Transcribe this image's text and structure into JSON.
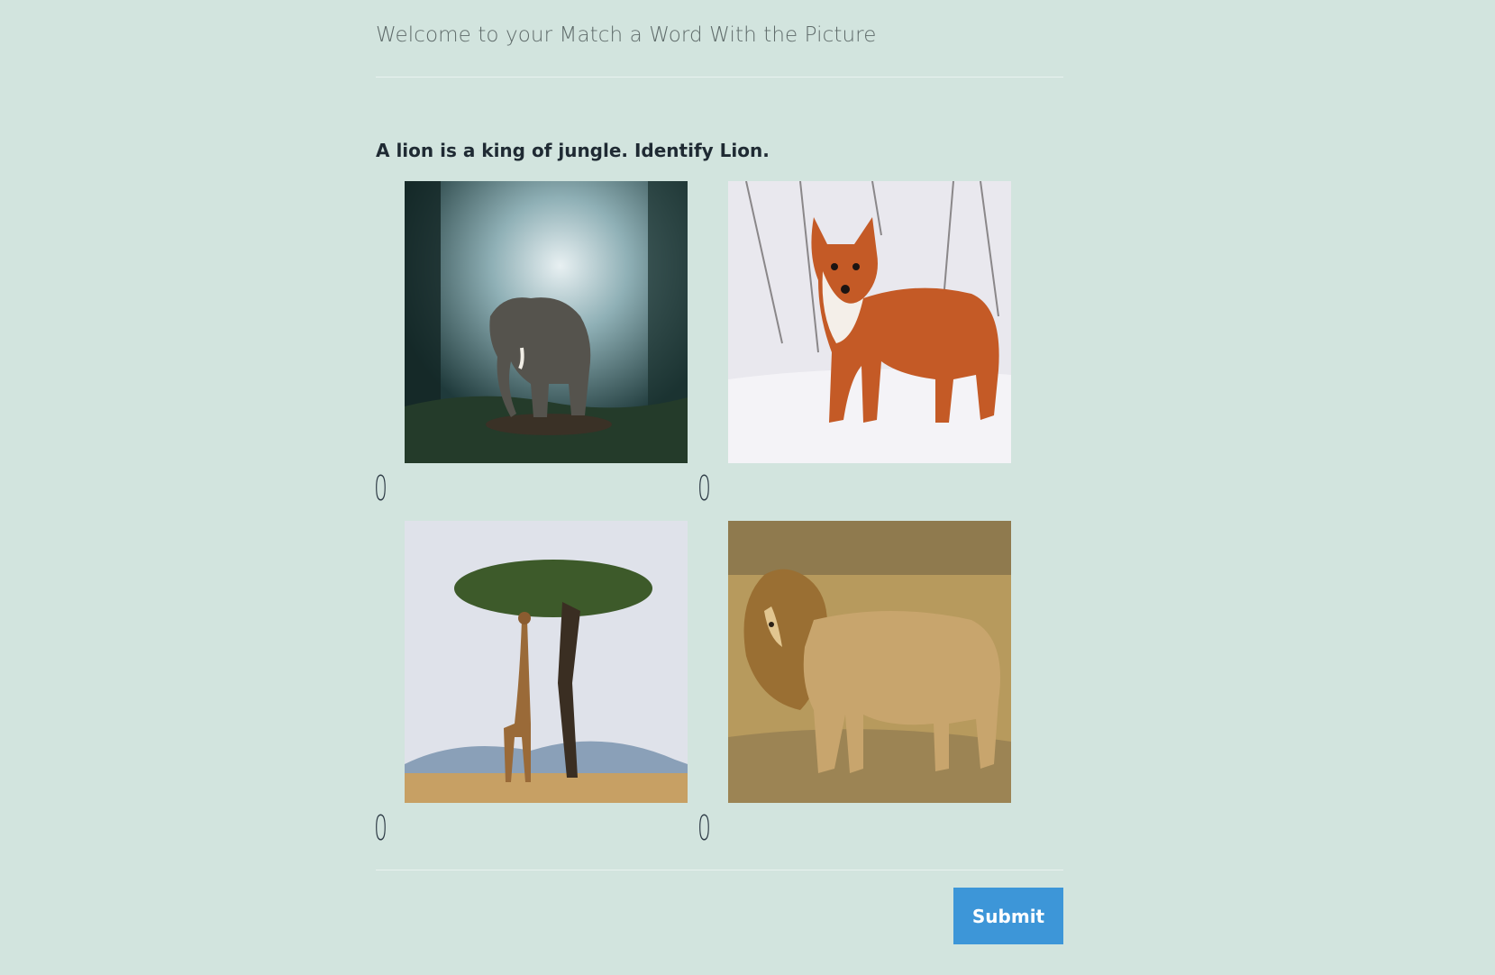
{
  "header": {
    "title": "Welcome to your Match a Word With the Picture"
  },
  "question": {
    "text": "A lion is a king of jungle. Identify Lion."
  },
  "options": [
    {
      "image": "elephant-photo",
      "label": "0"
    },
    {
      "image": "fox-photo",
      "label": "0"
    },
    {
      "image": "giraffe-photo",
      "label": "0"
    },
    {
      "image": "lion-photo",
      "label": "0"
    }
  ],
  "actions": {
    "submit_label": "Submit"
  },
  "colors": {
    "background": "#d2e4de",
    "submit": "#3d96d8"
  }
}
